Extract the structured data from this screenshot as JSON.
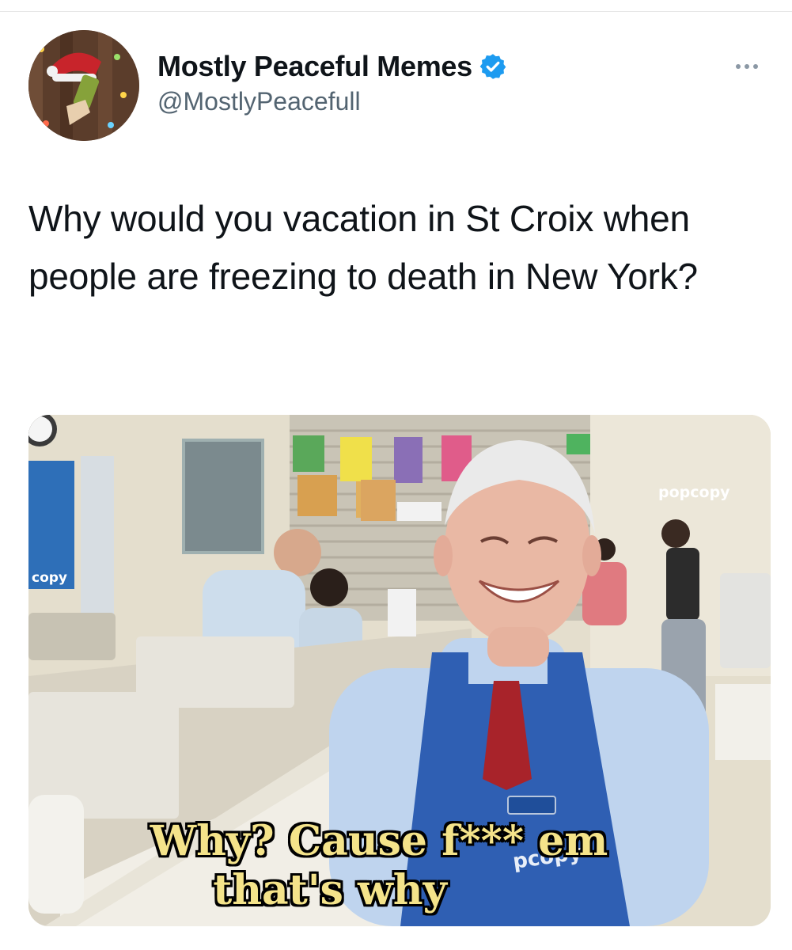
{
  "tweet": {
    "author": {
      "display_name": "Mostly Peaceful Memes",
      "handle": "@MostlyPeacefull",
      "verified": true,
      "avatar_icon": "avatar-icon",
      "badge_icon": "verified-badge-icon"
    },
    "more_icon": "more-options-icon",
    "text": "Why would you vacation in St Croix when people are freezing to death in New York?",
    "media": {
      "caption_line_1": "Why? Cause f*** em",
      "caption_line_2": "that's why",
      "sign_left": "copy",
      "sign_right": "popcopy",
      "apron_text": "pcopy"
    }
  },
  "colors": {
    "verified_blue": "#1d9bf0",
    "handle_gray": "#536471",
    "caption_yellow": "#f4e38a"
  }
}
